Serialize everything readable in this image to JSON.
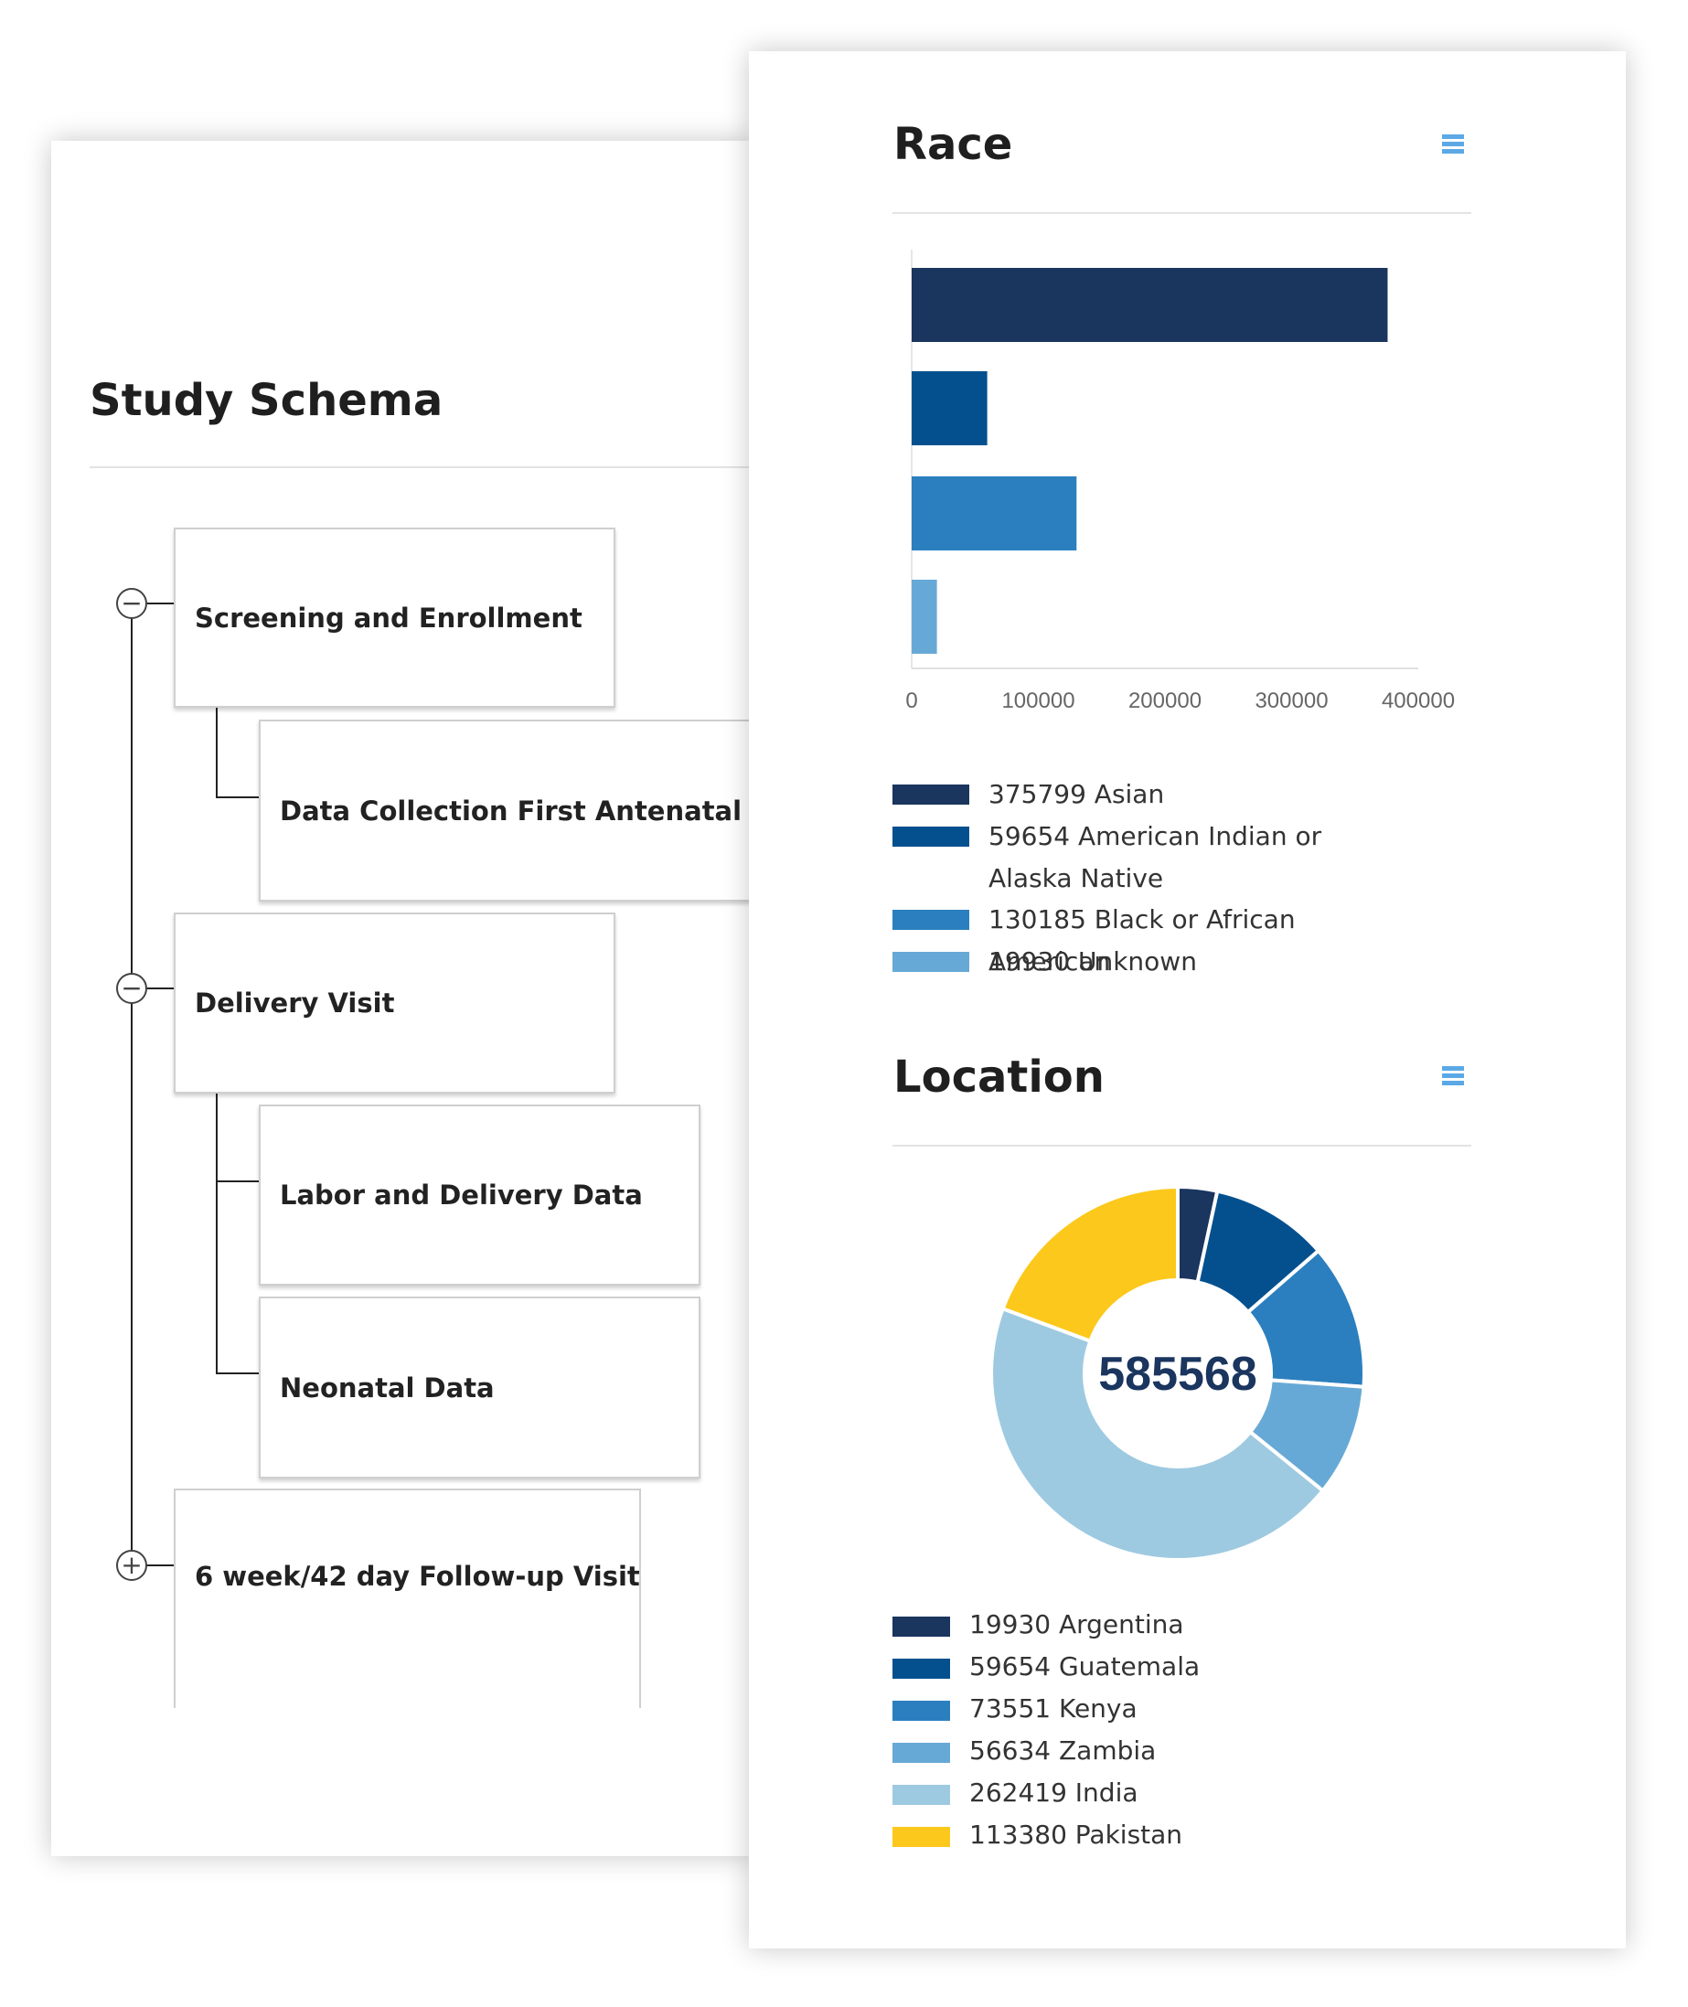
{
  "schema": {
    "title": "Study Schema",
    "nodes": [
      {
        "label": "Screening and Enrollment",
        "toggle": "minus"
      },
      {
        "label": "Data Collection First Antenatal Visit"
      },
      {
        "label": "Delivery Visit",
        "toggle": "minus"
      },
      {
        "label": "Labor and Delivery Data"
      },
      {
        "label": "Neonatal Data"
      },
      {
        "label": "6 week/42 day Follow-up Visit",
        "toggle": "plus"
      }
    ]
  },
  "icons": {
    "chart_menu": "menu-icon",
    "collapse": "minus-circle-icon",
    "expand": "plus-circle-icon"
  },
  "chart_data": [
    {
      "type": "bar",
      "orientation": "horizontal",
      "title": "Race",
      "categories": [
        "Asian",
        "American Indian or Alaska Native",
        "Black or African American",
        "Unknown"
      ],
      "values": [
        375799,
        59654,
        130185,
        19930
      ],
      "colors": [
        "#1a355e",
        "#04508f",
        "#2b7fbf",
        "#67a9d6"
      ],
      "xlim": [
        0,
        400000
      ],
      "xticks": [
        "0",
        "100000",
        "200000",
        "300000",
        "400000"
      ],
      "legend": [
        {
          "text": "375799 Asian"
        },
        {
          "text": "59654 American Indian or Alaska Native"
        },
        {
          "text": "130185 Black or African American"
        },
        {
          "text": "19930 Unknown"
        }
      ],
      "legend_position": "bottom",
      "grid": false
    },
    {
      "type": "pie",
      "donut": true,
      "title": "Location",
      "center_label": "585568",
      "categories": [
        "Argentina",
        "Guatemala",
        "Kenya",
        "Zambia",
        "India",
        "Pakistan"
      ],
      "values": [
        19930,
        59654,
        73551,
        56634,
        262419,
        113380
      ],
      "colors": [
        "#1a355e",
        "#04508f",
        "#2b7fbf",
        "#67a9d6",
        "#9ecae1",
        "#fcc81c"
      ],
      "legend": [
        {
          "text": "19930 Argentina"
        },
        {
          "text": "59654 Guatemala"
        },
        {
          "text": "73551 Kenya"
        },
        {
          "text": "56634 Zambia"
        },
        {
          "text": "262419 India"
        },
        {
          "text": "113380 Pakistan"
        }
      ],
      "legend_position": "bottom"
    }
  ]
}
